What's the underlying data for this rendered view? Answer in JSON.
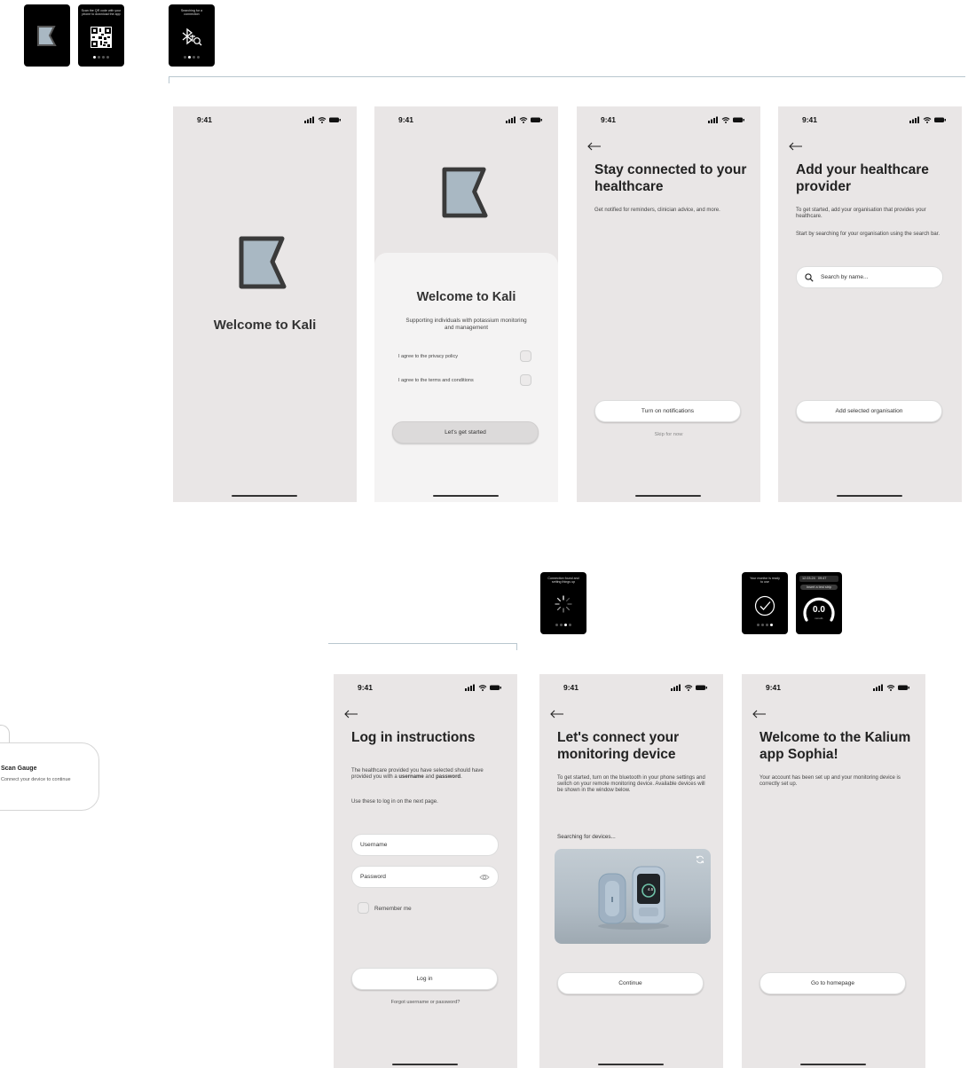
{
  "tiles": {
    "logo_tile": {},
    "qr_tile": {
      "caption": "Scan the QR code with your phone to download the app"
    },
    "bt_tile": {
      "caption": "Searching for a connection"
    },
    "conn_tile": {
      "caption": "Connection found and setting things up"
    },
    "ready_tile": {
      "caption": "Your monitor is ready to use"
    },
    "reading_tile": {
      "date": "12.03.24",
      "time": "09:47",
      "caption": "Insert a test strip",
      "value": "0.0",
      "unit": "mmol/L"
    }
  },
  "status": {
    "time": "9:41"
  },
  "splash": {
    "title": "Welcome to Kali"
  },
  "consent": {
    "title": "Welcome to Kali",
    "subtitle": "Supporting individuals with potassium monitoring and management",
    "privacy_label": "I agree to the privacy policy",
    "terms_label": "I agree to the terms and conditions",
    "button": "Let's get started"
  },
  "notifications": {
    "title": "Stay connected to your healthcare",
    "body": "Get notified for reminders, clinician advice, and more.",
    "button": "Turn on notifications",
    "skip": "Skip for now"
  },
  "provider": {
    "title": "Add your healthcare provider",
    "body1": "To get started, add your organisation that provides your healthcare.",
    "body2": "Start by searching for your organisation using the search bar.",
    "search_placeholder": "Search by name...",
    "button": "Add selected organisation"
  },
  "login": {
    "title": "Log in instructions",
    "body_pre": "The healthcare provided you have selected should have provided you with a ",
    "body_b1": "username",
    "body_mid": " and ",
    "body_b2": "password",
    "body_end": ".",
    "body2": "Use these to log in on the next page.",
    "username_placeholder": "Username",
    "password_placeholder": "Password",
    "remember": "Remember me",
    "button": "Log in",
    "forgot": "Forgot username or password?"
  },
  "connect": {
    "title": "Let's connect your monitoring device",
    "body": "To get started, turn on the bluetooth in your phone settings and switch on your remote monitoring device. Available devices will be shown in the window below.",
    "searching": "Searching for devices...",
    "device_reading": "4.5",
    "button": "Continue"
  },
  "welcome": {
    "title": "Welcome to the Kalium app Sophia!",
    "body": "Your account has been set up and your monitoring device is correctly set up.",
    "button": "Go to homepage"
  },
  "toast": {
    "title": "Scan Gauge",
    "subtitle": "Connect your device to continue"
  },
  "colors": {
    "screen_bg": "#e9e6e6",
    "logo_fill": "#a9b8c3",
    "logo_stroke": "#3a3a3a",
    "tile_bg": "#000000"
  }
}
